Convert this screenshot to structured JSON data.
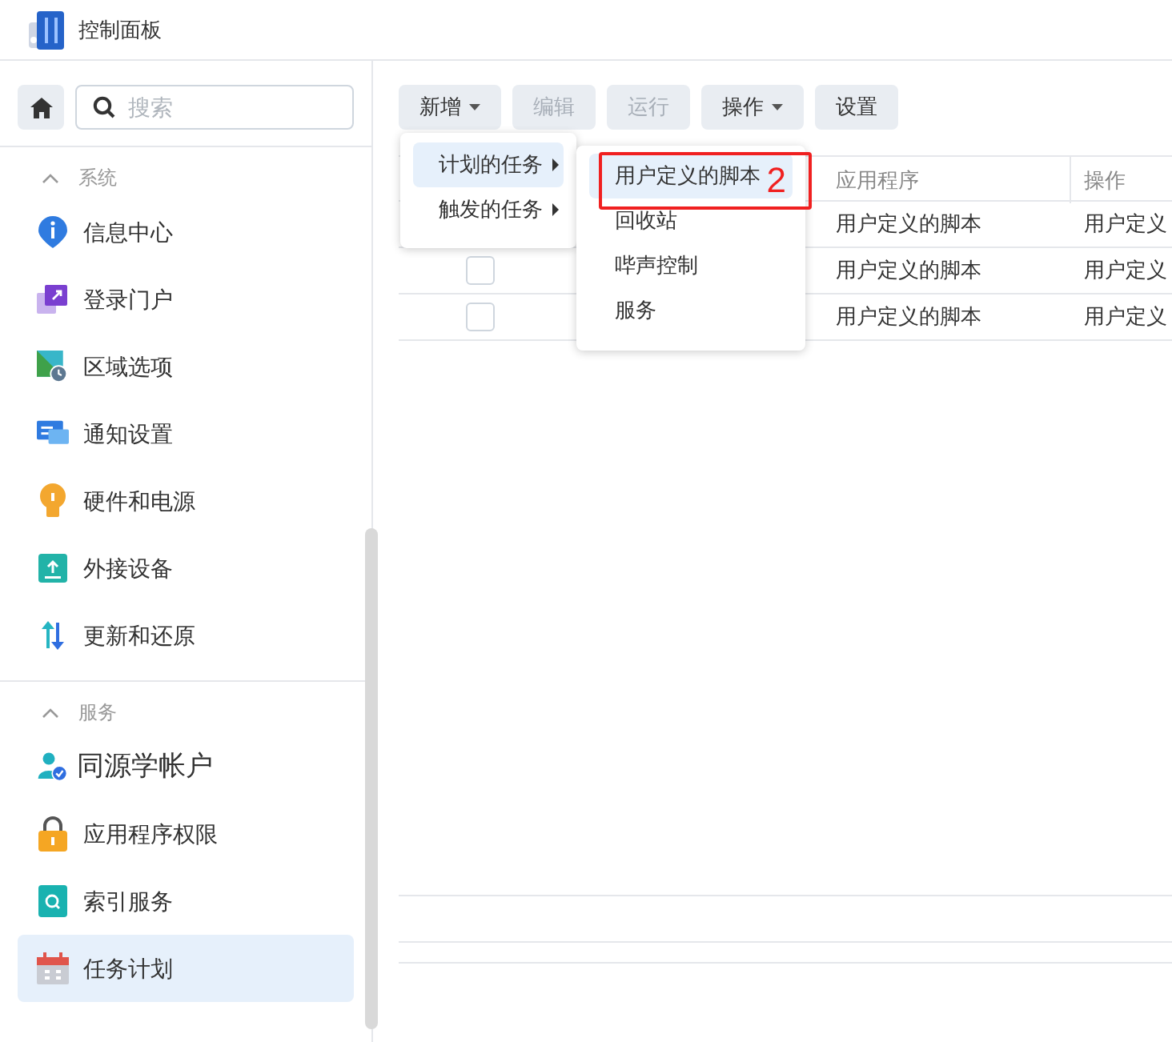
{
  "window": {
    "title": "控制面板"
  },
  "sidebar": {
    "search": {
      "placeholder": "搜索"
    },
    "sections": [
      {
        "title": "系统",
        "expanded": true,
        "items": [
          {
            "label": "信息中心",
            "selected": false
          },
          {
            "label": "登录门户",
            "selected": false
          },
          {
            "label": "区域选项",
            "selected": false
          },
          {
            "label": "通知设置",
            "selected": false
          },
          {
            "label": "硬件和电源",
            "selected": false
          },
          {
            "label": "外接设备",
            "selected": false
          },
          {
            "label": "更新和还原",
            "selected": false
          }
        ]
      },
      {
        "title": "服务",
        "expanded": true,
        "items": [
          {
            "label": "同源学帐户",
            "selected": false,
            "kind": "large"
          },
          {
            "label": "应用程序权限",
            "selected": false
          },
          {
            "label": "索引服务",
            "selected": false
          },
          {
            "label": "任务计划",
            "selected": true
          }
        ]
      }
    ]
  },
  "toolbar": [
    {
      "label": "新增",
      "dropdown": true,
      "disabled": false
    },
    {
      "label": "编辑",
      "dropdown": false,
      "disabled": true
    },
    {
      "label": "运行",
      "dropdown": false,
      "disabled": true
    },
    {
      "label": "操作",
      "dropdown": true,
      "disabled": false
    },
    {
      "label": "设置",
      "dropdown": false,
      "disabled": false
    }
  ],
  "table": {
    "columns": [
      "应用程序",
      "操作"
    ],
    "rows": [
      {
        "cells": [
          "用户定义的脚本",
          "用户定义"
        ]
      },
      {
        "checked": false,
        "cells": [
          "用户定义的脚本",
          "用户定义"
        ]
      },
      {
        "checked": false,
        "cells": [
          "用户定义的脚本",
          "用户定义"
        ]
      }
    ]
  },
  "menu": {
    "items": [
      {
        "label": "计划的任务",
        "selected": true
      },
      {
        "label": "触发的任务",
        "selected": false
      }
    ]
  },
  "submenu": {
    "items": [
      {
        "label": "用户定义的脚本",
        "selected": true
      },
      {
        "label": "回收站",
        "selected": false
      },
      {
        "label": "哔声控制",
        "selected": false
      },
      {
        "label": "服务",
        "selected": false
      }
    ]
  },
  "annotation": {
    "label": "2"
  }
}
